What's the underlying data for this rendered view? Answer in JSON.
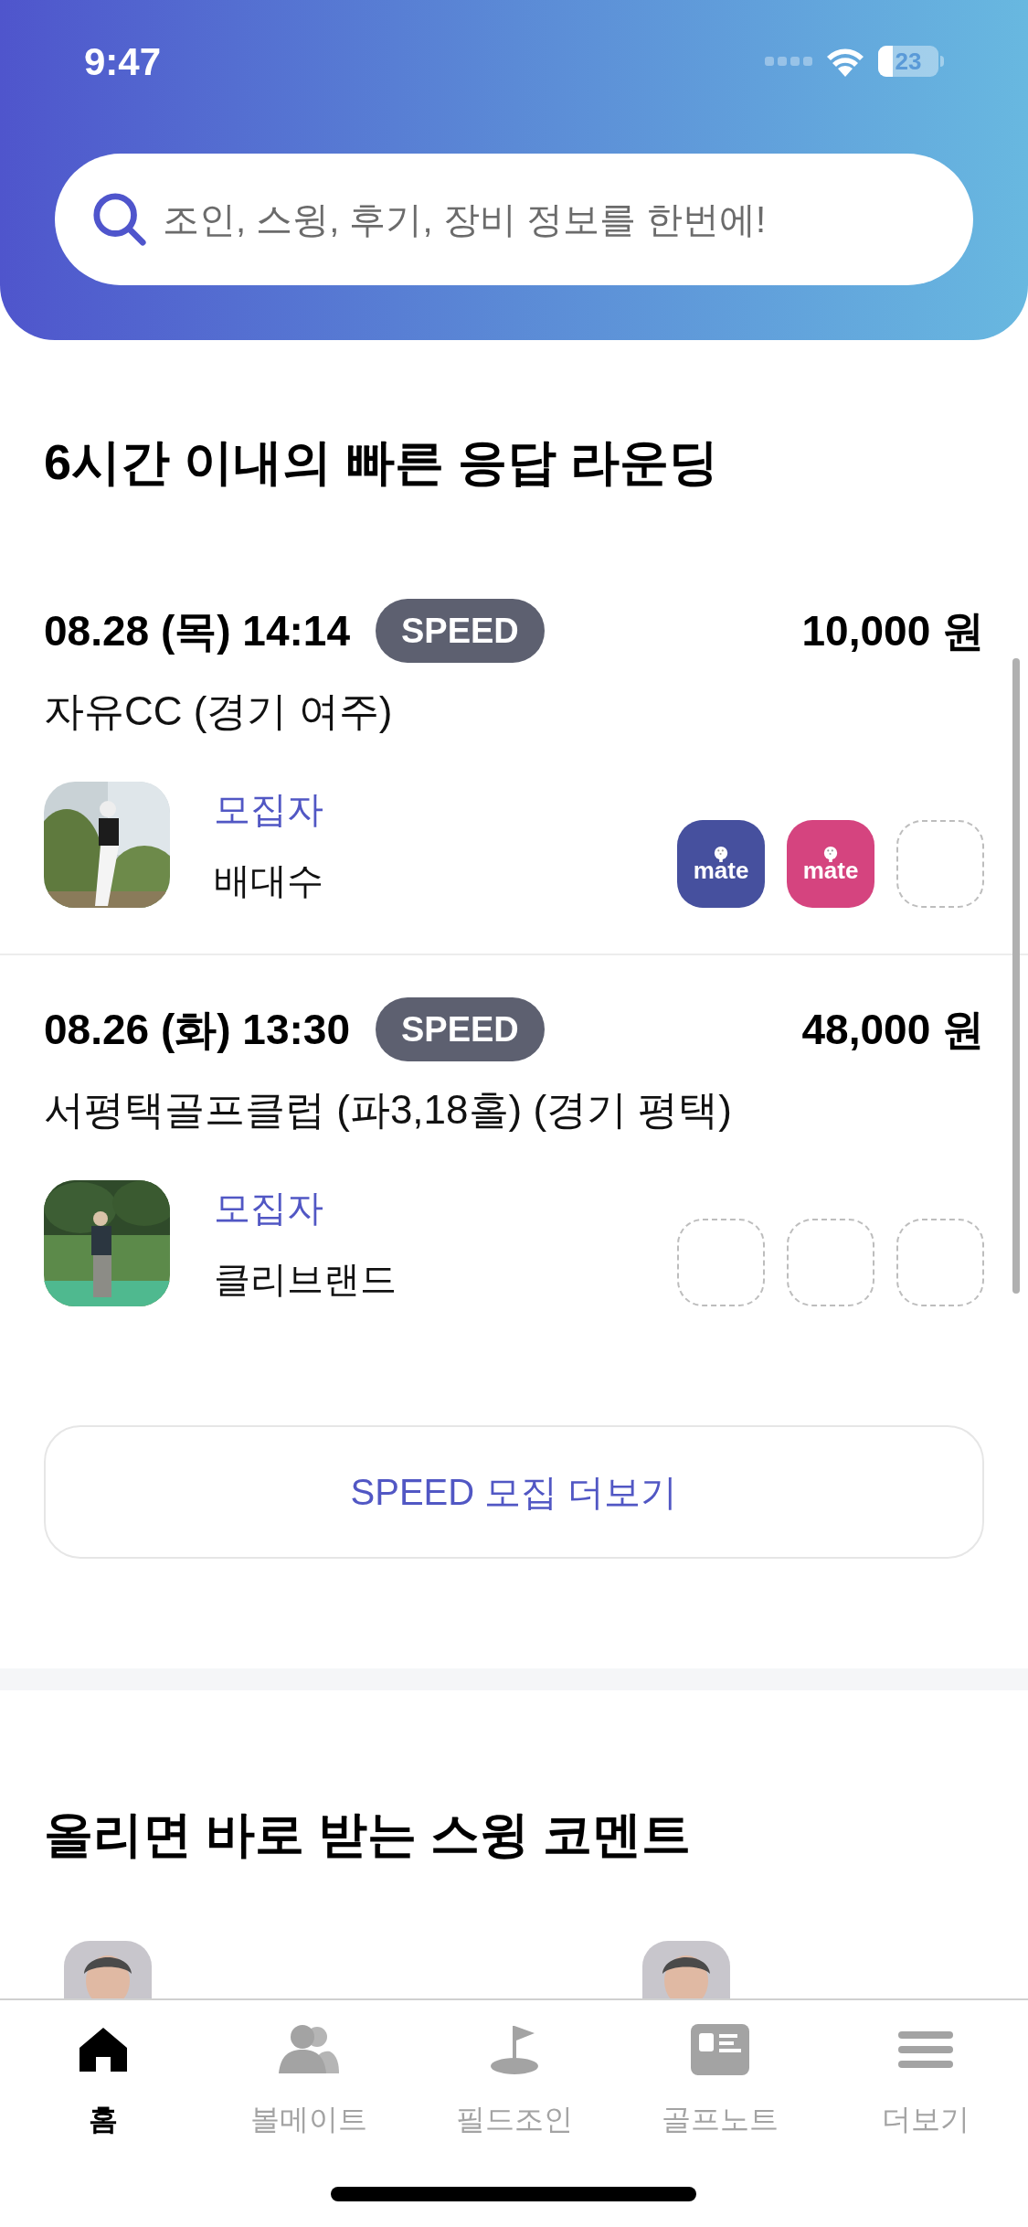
{
  "status_bar": {
    "time": "9:47",
    "battery": "23"
  },
  "search": {
    "placeholder": "조인, 스윙, 후기, 장비 정보를 한번에!"
  },
  "speed_section": {
    "title": "6시간 이내의 빠른 응답 라운딩",
    "rounds": [
      {
        "datetime": "08.28 (목) 14:14",
        "badge": "SPEED",
        "price": "10,000 원",
        "venue": "자유CC (경기 여주)",
        "host_label": "모집자",
        "host_name": "배대수",
        "slots": [
          {
            "kind": "mate",
            "label": "mate",
            "color": "#46509e"
          },
          {
            "kind": "mate",
            "label": "mate",
            "color": "#d5447f"
          },
          {
            "kind": "empty"
          }
        ]
      },
      {
        "datetime": "08.26 (화) 13:30",
        "badge": "SPEED",
        "price": "48,000 원",
        "venue": "서평택골프클럽 (파3,18홀) (경기 평택)",
        "host_label": "모집자",
        "host_name": "클리브랜드",
        "slots": [
          {
            "kind": "empty"
          },
          {
            "kind": "empty"
          },
          {
            "kind": "empty"
          }
        ]
      }
    ],
    "more_button": "SPEED 모집 더보기"
  },
  "swing_section": {
    "title": "올리면 바로 받는 스윙 코멘트"
  },
  "tab_bar": [
    {
      "label": "홈",
      "selected": true
    },
    {
      "label": "볼메이트",
      "selected": false
    },
    {
      "label": "필드조인",
      "selected": false
    },
    {
      "label": "골프노트",
      "selected": false
    },
    {
      "label": "더보기",
      "selected": false
    }
  ]
}
